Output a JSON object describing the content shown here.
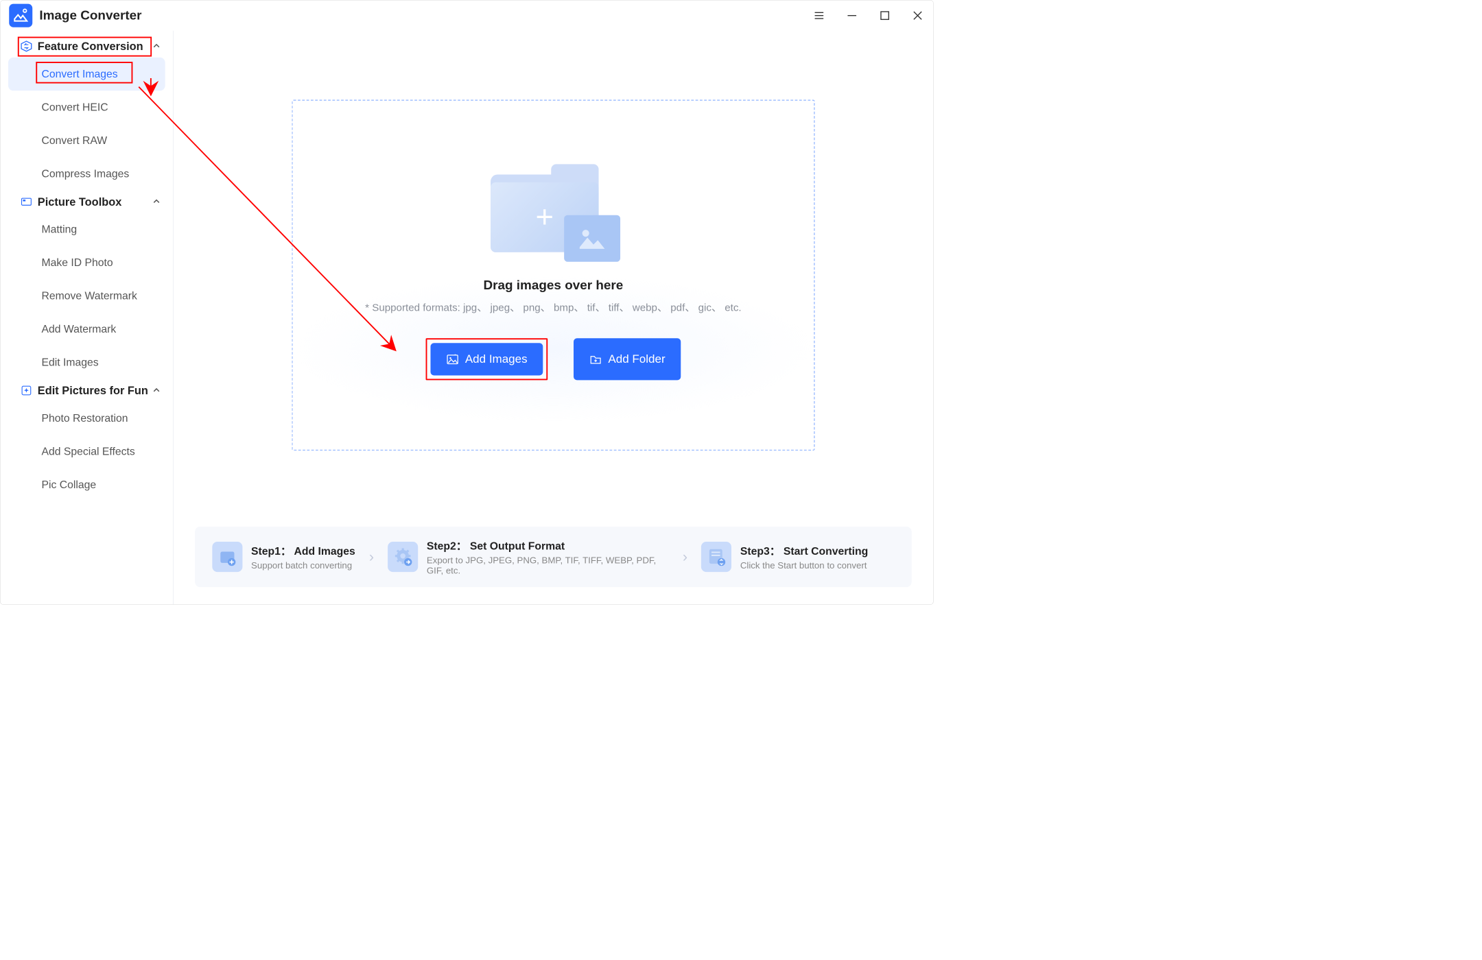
{
  "app": {
    "title": "Image Converter"
  },
  "sidebar": {
    "categories": [
      {
        "label": "Feature Conversion",
        "items": [
          "Convert Images",
          "Convert HEIC",
          "Convert RAW",
          "Compress Images"
        ],
        "active_index": 0
      },
      {
        "label": "Picture Toolbox",
        "items": [
          "Matting",
          "Make ID Photo",
          "Remove Watermark",
          "Add Watermark",
          "Edit Images"
        ]
      },
      {
        "label": "Edit Pictures for Fun",
        "items": [
          "Photo Restoration",
          "Add Special Effects",
          "Pic Collage"
        ]
      }
    ]
  },
  "dropzone": {
    "drag_text": "Drag images over here",
    "supported": "* Supported formats: jpg、 jpeg、 png、 bmp、 tif、 tiff、 webp、 pdf、 gic、 etc.",
    "add_images": "Add Images",
    "add_folder": "Add Folder"
  },
  "steps": [
    {
      "title": "Step1： Add Images",
      "sub": "Support batch converting"
    },
    {
      "title": "Step2： Set Output Format",
      "sub": "Export to JPG, JPEG, PNG, BMP, TIF, TIFF, WEBP, PDF, GIF, etc."
    },
    {
      "title": "Step3： Start Converting",
      "sub": "Click the Start button to convert"
    }
  ]
}
